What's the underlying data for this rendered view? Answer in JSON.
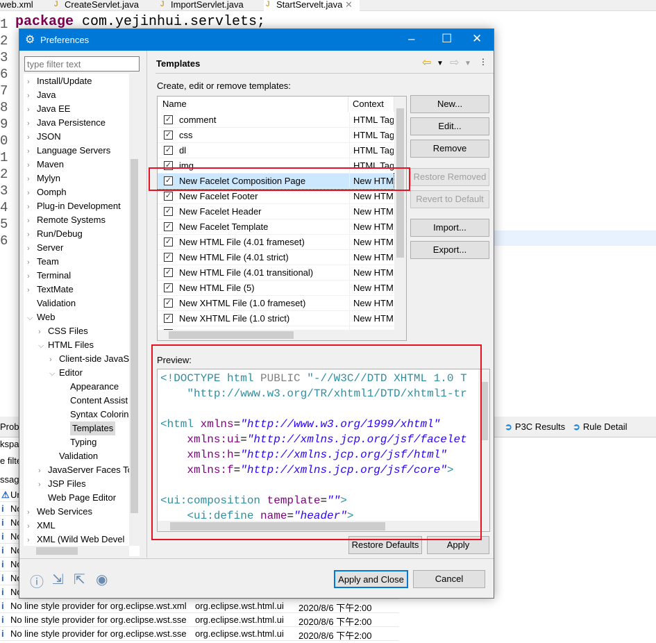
{
  "editor": {
    "tabs": [
      "web.xml",
      "CreateServlet.java",
      "ImportServlet.java",
      "StartServelt.java"
    ],
    "active_tab": "StartServelt.java",
    "code_keyword": "package",
    "code_rest": " com.yejinhui.servlets;",
    "line_numbers": [
      "1",
      "2",
      "3",
      "6",
      "7",
      "8",
      "9",
      "0",
      "1",
      "2",
      "3",
      "4",
      "5",
      "6"
    ]
  },
  "bottom_panel": {
    "tabs": [
      "P3C Results",
      "Rule Detail"
    ],
    "left_fragments": [
      "Probl",
      "kspa",
      "e filte",
      "ssag"
    ],
    "rows": [
      {
        "msg": "Ur",
        "res": "",
        "date": ""
      },
      {
        "msg": "No",
        "res": "",
        "date": ""
      },
      {
        "msg": "No",
        "res": "",
        "date": ""
      },
      {
        "msg": "No",
        "res": "",
        "date": ""
      },
      {
        "msg": "No",
        "res": "",
        "date": ""
      },
      {
        "msg": "No",
        "res": "",
        "date": ""
      },
      {
        "msg": "No",
        "res": "",
        "date": ""
      },
      {
        "msg": "No",
        "res": "",
        "date": ""
      },
      {
        "msg": "No line style provider for org.eclipse.wst.xml",
        "res": "org.eclipse.wst.html.ui",
        "date": "2020/8/6 下午2:00"
      },
      {
        "msg": "No line style provider for org.eclipse.wst.sse",
        "res": "org.eclipse.wst.html.ui",
        "date": "2020/8/6 下午2:00"
      },
      {
        "msg": "No line style provider for org.eclipse.wst.sse",
        "res": "org.eclipse.wst.html.ui",
        "date": "2020/8/6 下午2:00"
      }
    ]
  },
  "dialog": {
    "title": "Preferences",
    "filter_placeholder": "type filter text",
    "tree": [
      {
        "label": "Install/Update",
        "level": 0,
        "chev": ">"
      },
      {
        "label": "Java",
        "level": 0,
        "chev": ">"
      },
      {
        "label": "Java EE",
        "level": 0,
        "chev": ">"
      },
      {
        "label": "Java Persistence",
        "level": 0,
        "chev": ">"
      },
      {
        "label": "JSON",
        "level": 0,
        "chev": ">"
      },
      {
        "label": "Language Servers",
        "level": 0,
        "chev": ">"
      },
      {
        "label": "Maven",
        "level": 0,
        "chev": ">"
      },
      {
        "label": "Mylyn",
        "level": 0,
        "chev": ">"
      },
      {
        "label": "Oomph",
        "level": 0,
        "chev": ">"
      },
      {
        "label": "Plug-in Development",
        "level": 0,
        "chev": ">"
      },
      {
        "label": "Remote Systems",
        "level": 0,
        "chev": ">"
      },
      {
        "label": "Run/Debug",
        "level": 0,
        "chev": ">"
      },
      {
        "label": "Server",
        "level": 0,
        "chev": ">"
      },
      {
        "label": "Team",
        "level": 0,
        "chev": ">"
      },
      {
        "label": "Terminal",
        "level": 0,
        "chev": ">"
      },
      {
        "label": "TextMate",
        "level": 0,
        "chev": ">"
      },
      {
        "label": "Validation",
        "level": 0,
        "chev": ""
      },
      {
        "label": "Web",
        "level": 0,
        "chev": "v"
      },
      {
        "label": "CSS Files",
        "level": 1,
        "chev": ">"
      },
      {
        "label": "HTML Files",
        "level": 1,
        "chev": "v"
      },
      {
        "label": "Client-side JavaS",
        "level": 2,
        "chev": ">"
      },
      {
        "label": "Editor",
        "level": 2,
        "chev": "v"
      },
      {
        "label": "Appearance",
        "level": 3,
        "chev": ""
      },
      {
        "label": "Content Assist",
        "level": 3,
        "chev": ""
      },
      {
        "label": "Syntax Colorin",
        "level": 3,
        "chev": ""
      },
      {
        "label": "Templates",
        "level": 3,
        "chev": "",
        "selected": true
      },
      {
        "label": "Typing",
        "level": 3,
        "chev": ""
      },
      {
        "label": "Validation",
        "level": 2,
        "chev": ""
      },
      {
        "label": "JavaServer Faces To",
        "level": 1,
        "chev": ">"
      },
      {
        "label": "JSP Files",
        "level": 1,
        "chev": ">"
      },
      {
        "label": "Web Page Editor",
        "level": 1,
        "chev": ""
      },
      {
        "label": "Web Services",
        "level": 0,
        "chev": ">"
      },
      {
        "label": "XML",
        "level": 0,
        "chev": ">"
      },
      {
        "label": "XML (Wild Web Devel",
        "level": 0,
        "chev": ">"
      }
    ],
    "page_title": "Templates",
    "table_label": "Create, edit or remove templates:",
    "columns": [
      "Name",
      "Context"
    ],
    "templates": [
      {
        "name": "comment",
        "context": "HTML Tag",
        "checked": true
      },
      {
        "name": "css",
        "context": "HTML Tag",
        "checked": true
      },
      {
        "name": "dl",
        "context": "HTML Tag",
        "checked": true
      },
      {
        "name": "img",
        "context": "HTML Tag",
        "checked": true
      },
      {
        "name": "New Facelet Composition Page",
        "context": "New HTML",
        "checked": true,
        "selected": true
      },
      {
        "name": "New Facelet Footer",
        "context": "New HTML",
        "checked": true
      },
      {
        "name": "New Facelet Header",
        "context": "New HTML",
        "checked": true
      },
      {
        "name": "New Facelet Template",
        "context": "New HTML",
        "checked": true
      },
      {
        "name": "New HTML File (4.01 frameset)",
        "context": "New HTML",
        "checked": true
      },
      {
        "name": "New HTML File (4.01 strict)",
        "context": "New HTML",
        "checked": true
      },
      {
        "name": "New HTML File (4.01 transitional)",
        "context": "New HTML",
        "checked": true
      },
      {
        "name": "New HTML File (5)",
        "context": "New HTML",
        "checked": true
      },
      {
        "name": "New XHTML File (1.0 frameset)",
        "context": "New HTML",
        "checked": true
      },
      {
        "name": "New XHTML File (1.0 strict)",
        "context": "New HTML",
        "checked": true
      },
      {
        "name": "New XHTML File (1.0 transitional)",
        "context": "New HTML",
        "checked": true
      }
    ],
    "buttons": {
      "new": "New...",
      "edit": "Edit...",
      "remove": "Remove",
      "restore_removed": "Restore Removed",
      "revert": "Revert to Default",
      "import": "Import...",
      "export": "Export...",
      "restore_defaults": "Restore Defaults",
      "apply": "Apply",
      "apply_close": "Apply and Close",
      "cancel": "Cancel"
    },
    "preview_label": "Preview:",
    "preview": {
      "l1a": "<!DOCTYPE html ",
      "l1b": "PUBLIC ",
      "l1c": "\"-//W3C//DTD XHTML 1.0 T",
      "l2": "    \"http://www.w3.org/TR/xhtml1/DTD/xhtml1-tr",
      "l4a": "<html ",
      "l4b": "xmlns",
      "l4c": "=",
      "l4d": "\"http://www.w3.org/1999/xhtml\"",
      "l5b": "    xmlns:ui",
      "l5d": "\"http://xmlns.jcp.org/jsf/facelet",
      "l6b": "    xmlns:h",
      "l6d": "\"http://xmlns.jcp.org/jsf/html\"",
      "l7b": "    xmlns:f",
      "l7d": "\"http://xmlns.jcp.org/jsf/core\"",
      "l7e": ">",
      "l9a": "<ui:composition ",
      "l9b": "template",
      "l9d": "\"\"",
      "l9e": ">",
      "l10a": "    <ui:define ",
      "l10b": "name",
      "l10d": "\"header\"",
      "l10e": ">"
    },
    "highlight_color": "#e81123",
    "title_color": "#0078d7"
  }
}
